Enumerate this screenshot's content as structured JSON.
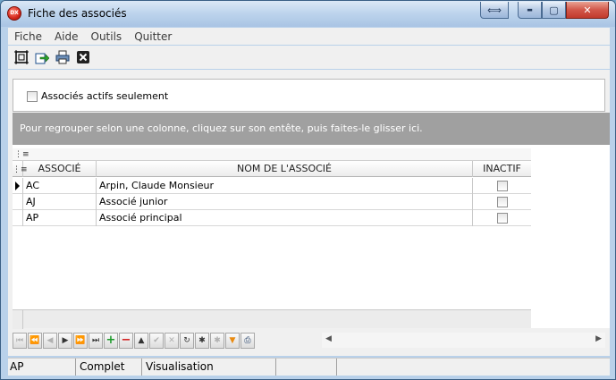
{
  "window": {
    "title": "Fiche des associés",
    "app_icon_text": "DX",
    "resize_glyph": "⟺",
    "minimize_glyph": "▬",
    "maximize_glyph": "▢",
    "close_glyph": "✕"
  },
  "menu": [
    "Fiche",
    "Aide",
    "Outils",
    "Quitter"
  ],
  "toolbar": {
    "icons": [
      "fit-window-icon",
      "export-icon",
      "print-icon",
      "close-form-icon"
    ]
  },
  "filter": {
    "active_only_label": "Associés actifs seulement",
    "active_only_checked": false
  },
  "grid": {
    "group_hint": "Pour regrouper selon une colonne, cliquez sur son entête, puis faites-le glisser ici.",
    "columns": [
      "ASSOCIÉ",
      "NOM DE L'ASSOCIÉ",
      "INACTIF"
    ],
    "rows": [
      {
        "code": "AC",
        "name": "Arpin, Claude Monsieur",
        "inactive": false,
        "current": true
      },
      {
        "code": "AJ",
        "name": "Associé junior",
        "inactive": false,
        "current": false
      },
      {
        "code": "AP",
        "name": "Associé principal",
        "inactive": false,
        "current": false
      }
    ]
  },
  "navigator": {
    "buttons": [
      {
        "name": "first-record-button",
        "glyph": "⏮",
        "enabled": false
      },
      {
        "name": "prev-page-button",
        "glyph": "⏪",
        "enabled": false
      },
      {
        "name": "prev-record-button",
        "glyph": "◀",
        "enabled": false
      },
      {
        "name": "next-record-button",
        "glyph": "▶",
        "enabled": true
      },
      {
        "name": "next-page-button",
        "glyph": "⏩",
        "enabled": true
      },
      {
        "name": "last-record-button",
        "glyph": "⏭",
        "enabled": true
      },
      {
        "name": "add-record-button",
        "glyph": "+",
        "enabled": true
      },
      {
        "name": "delete-record-button",
        "glyph": "−",
        "enabled": true
      },
      {
        "name": "edit-record-button",
        "glyph": "▲",
        "enabled": true
      },
      {
        "name": "post-record-button",
        "glyph": "✔",
        "enabled": false
      },
      {
        "name": "cancel-edit-button",
        "glyph": "✕",
        "enabled": false
      },
      {
        "name": "refresh-button",
        "glyph": "↻",
        "enabled": true
      },
      {
        "name": "bookmark-button",
        "glyph": "✱",
        "enabled": true
      },
      {
        "name": "goto-bookmark-button",
        "glyph": "✱",
        "enabled": false
      },
      {
        "name": "filter-button",
        "glyph": "▼",
        "enabled": true
      },
      {
        "name": "print-grid-button",
        "glyph": "⎙",
        "enabled": true
      }
    ],
    "scroll_left": "◀",
    "scroll_right": "▶"
  },
  "status": {
    "panels": [
      "AP",
      "Complet",
      "Visualisation",
      "",
      ""
    ]
  },
  "colors": {
    "accent": "#3a5f85",
    "add_green": "#1d9a2a",
    "delete_red": "#d21a1a",
    "filter_orange": "#e98a10"
  }
}
